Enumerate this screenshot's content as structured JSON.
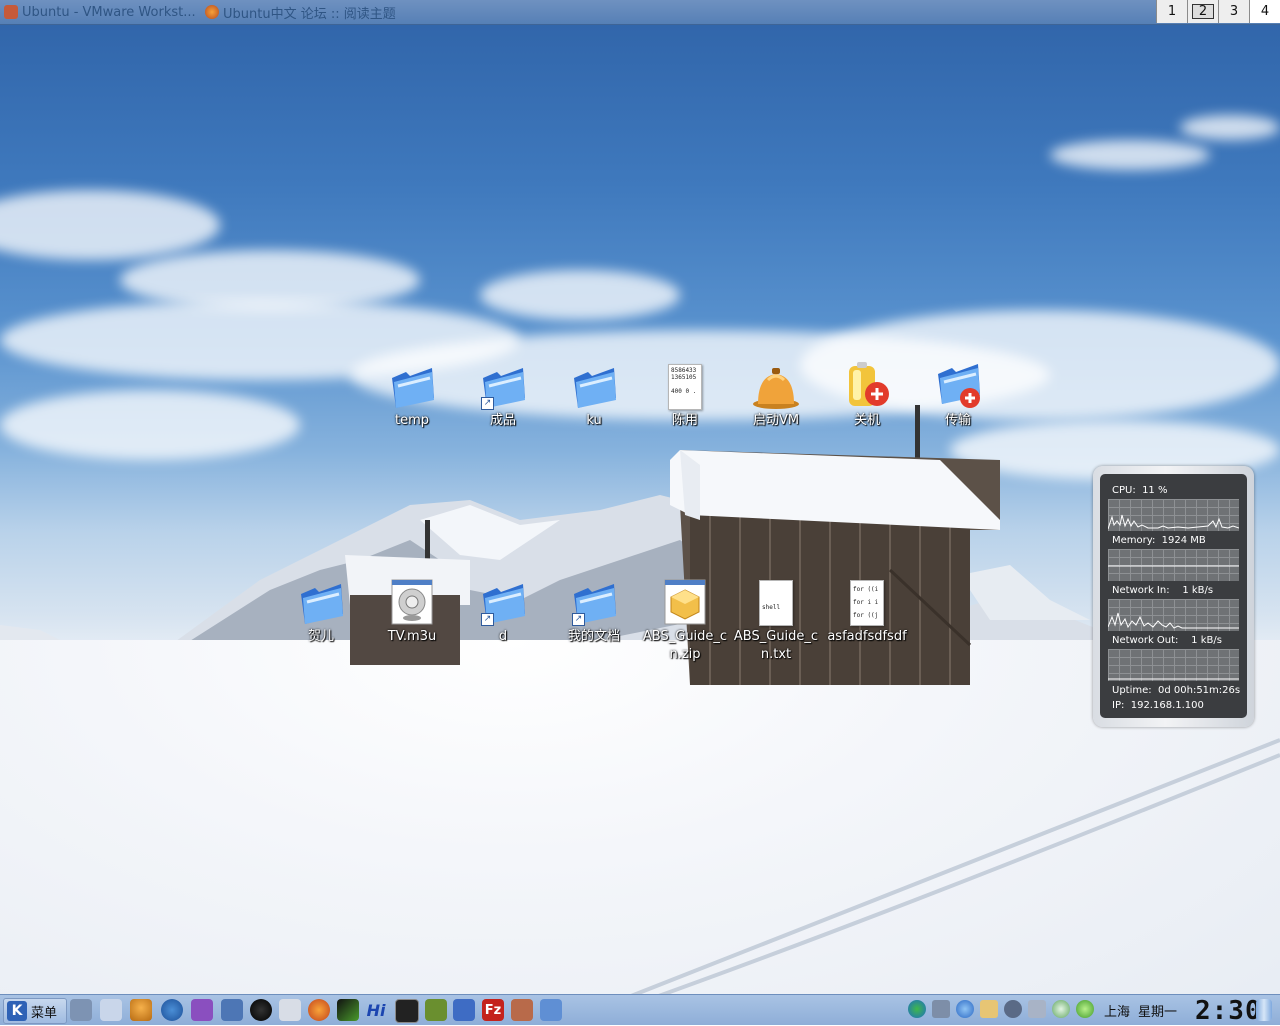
{
  "taskbar": {
    "tasks": [
      "Ubuntu - VMware Workst...",
      "Ubuntu中文 论坛 :: 阅读主题"
    ],
    "pager": [
      "1",
      "2",
      "3",
      "4"
    ],
    "active_desktop": "4"
  },
  "desktop": {
    "icons": [
      {
        "label": "temp",
        "icon": "folder-icon"
      },
      {
        "label": "成品",
        "icon": "folder-shortcut-icon"
      },
      {
        "label": "ku",
        "icon": "folder-icon"
      },
      {
        "label": "陈用",
        "icon": "text-document-icon",
        "preview": [
          "8586433",
          "1365105",
          "",
          "400 0 ."
        ]
      },
      {
        "label": "启动VM",
        "icon": "vm-launcher-icon"
      },
      {
        "label": "关机",
        "icon": "shutdown-icon"
      },
      {
        "label": "传输",
        "icon": "folder-transfer-icon"
      },
      {
        "label": "贺儿",
        "icon": "folder-icon"
      },
      {
        "label": "TV.m3u",
        "icon": "playlist-icon"
      },
      {
        "label": "d",
        "icon": "folder-shortcut-icon"
      },
      {
        "label": "我的文档",
        "icon": "folder-shortcut-icon"
      },
      {
        "label": "ABS_Guide_cn.zip",
        "icon": "zip-archive-icon"
      },
      {
        "label": "ABS_Guide_cn.txt",
        "icon": "shell-script-icon",
        "preview": [
          "",
          "",
          "shell"
        ]
      },
      {
        "label": "asfadfsdfsdf",
        "icon": "text-document-icon",
        "preview": [
          "for ((i",
          "for i i",
          "for ((j"
        ]
      }
    ]
  },
  "monitor": {
    "cpu_label": "CPU:",
    "cpu_value": "11 %",
    "memory_label": "Memory:",
    "memory_value": "1924 MB",
    "net_in_label": "Network In:",
    "net_in_value": "1 kB/s",
    "net_out_label": "Network Out:",
    "net_out_value": "1 kB/s",
    "uptime_label": "Uptime:",
    "uptime_value": "0d 00h:51m:26s",
    "ip_label": "IP:",
    "ip_value": "192.168.1.100"
  },
  "panel": {
    "menu_label": "菜单",
    "launchers": [
      "desktop-icon",
      "paint-icon",
      "vm-icon",
      "thunderbird-icon",
      "pidgin-icon",
      "monitor-icon",
      "qq-icon",
      "printer-icon",
      "firefox-icon",
      "terminal-green-icon",
      "baidu-hi-icon",
      "console-icon",
      "book-icon",
      "tools-icon",
      "filezilla-icon",
      "package-icon",
      "network-icon"
    ],
    "launcher_text": {
      "hi": "Hi",
      "fz": "Fz"
    },
    "tray_icons": [
      "msn-icon",
      "volume-icon",
      "network-status-icon",
      "klipper-icon",
      "security-icon",
      "connection-icon",
      "update-icon",
      "check-icon"
    ],
    "city": "上海",
    "weekday": "星期一",
    "clock": "2:30"
  },
  "colors": {
    "topbar": "#5e86bb",
    "panel": "#9bb8de",
    "folder_blue": "#3f86e0"
  }
}
